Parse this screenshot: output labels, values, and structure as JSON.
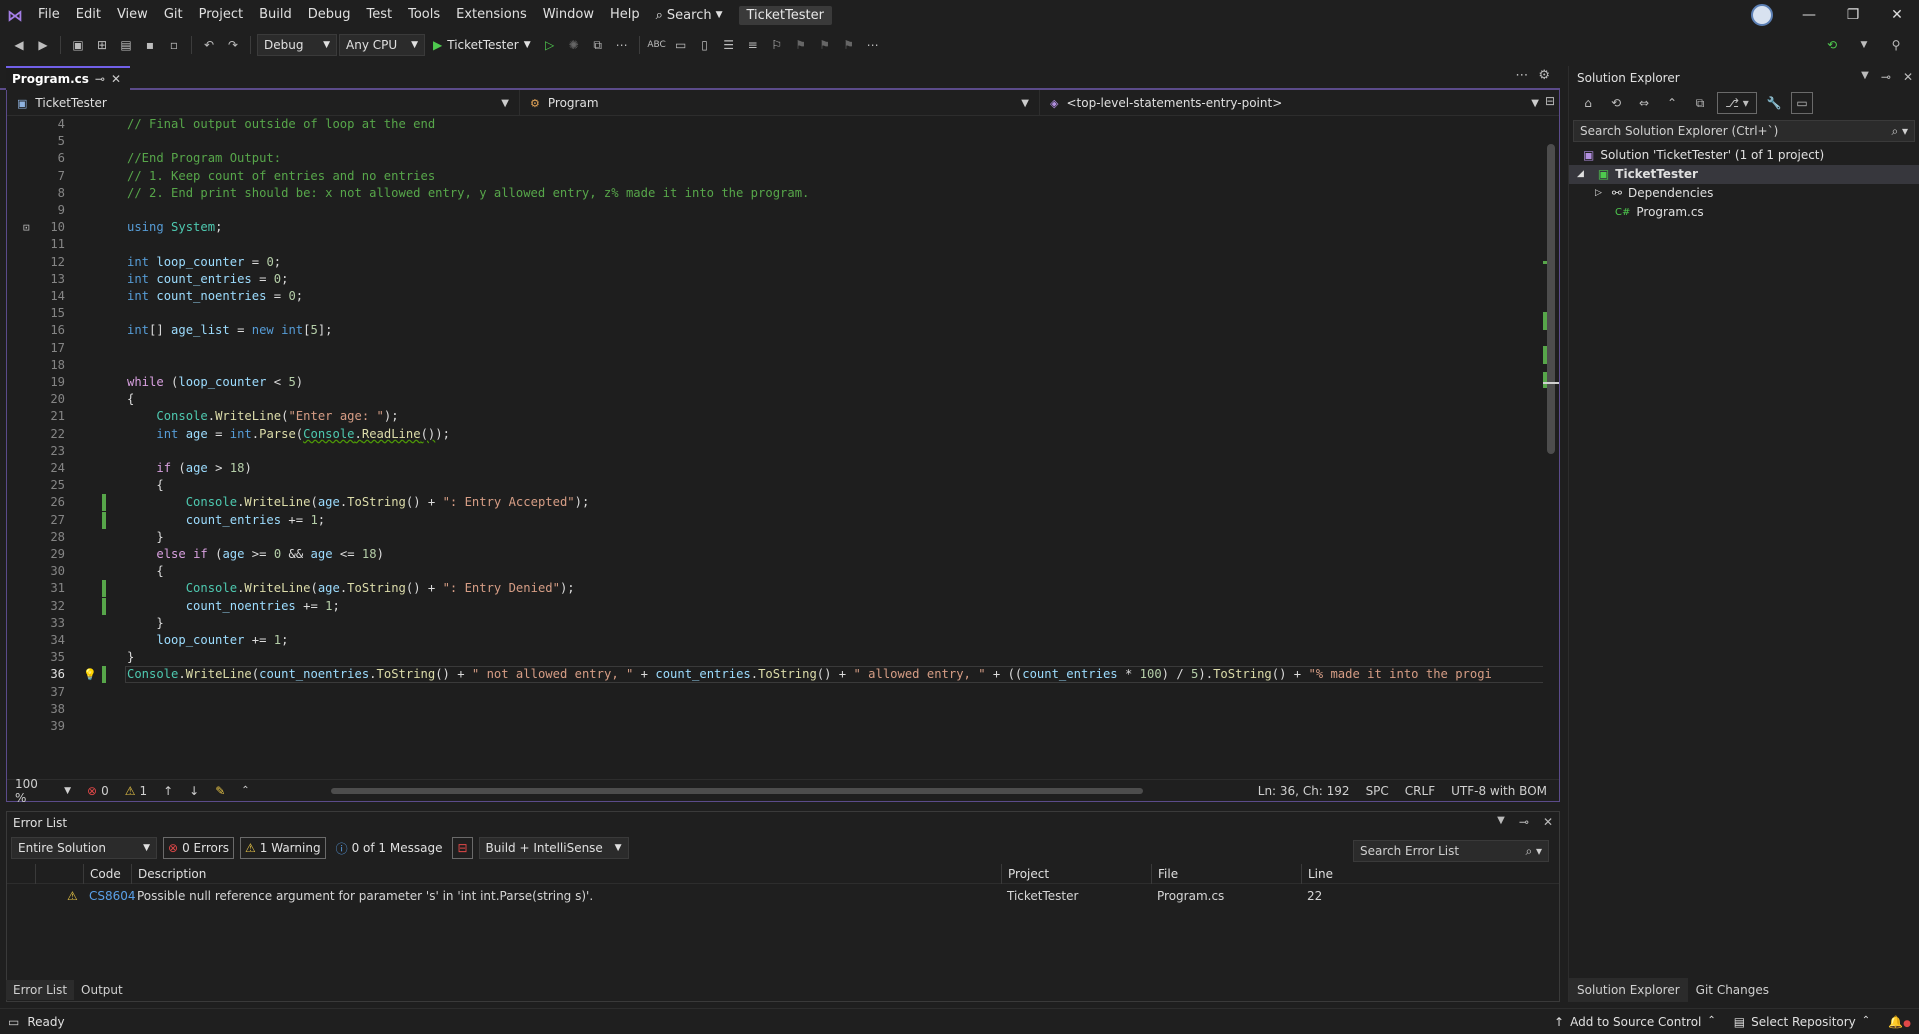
{
  "menu": {
    "items": [
      "File",
      "Edit",
      "View",
      "Git",
      "Project",
      "Build",
      "Debug",
      "Test",
      "Tools",
      "Extensions",
      "Window",
      "Help"
    ],
    "search_label": "Search",
    "solution_title": "TicketTester"
  },
  "toolbar": {
    "config": "Debug",
    "platform": "Any CPU",
    "run_target": "TicketTester"
  },
  "document": {
    "tab_name": "Program.cs",
    "nav_project": "TicketTester",
    "nav_class": "Program",
    "nav_member": "<top-level-statements-entry-point>"
  },
  "code_lines": [
    {
      "n": "4",
      "t": "    // Final output outside of loop at the end"
    },
    {
      "n": "5",
      "t": ""
    },
    {
      "n": "6",
      "t": "    //End Program Output:"
    },
    {
      "n": "7",
      "t": "    // 1. Keep count of entries and no entries"
    },
    {
      "n": "8",
      "t": "    // 2. End print should be: x not allowed entry, y allowed entry, z% made it into the program."
    },
    {
      "n": "9",
      "t": ""
    },
    {
      "n": "10",
      "t": "    using System;"
    },
    {
      "n": "11",
      "t": ""
    },
    {
      "n": "12",
      "t": "    int loop_counter = 0;"
    },
    {
      "n": "13",
      "t": "    int count_entries = 0;"
    },
    {
      "n": "14",
      "t": "    int count_noentries = 0;"
    },
    {
      "n": "15",
      "t": ""
    },
    {
      "n": "16",
      "t": "    int[] age_list = new int[5];"
    },
    {
      "n": "17",
      "t": ""
    },
    {
      "n": "18",
      "t": ""
    },
    {
      "n": "19",
      "t": "    while (loop_counter < 5)"
    },
    {
      "n": "20",
      "t": "    {"
    },
    {
      "n": "21",
      "t": "        Console.WriteLine(\"Enter age: \");"
    },
    {
      "n": "22",
      "t": "        int age = int.Parse(Console.ReadLine());"
    },
    {
      "n": "23",
      "t": ""
    },
    {
      "n": "24",
      "t": "        if (age > 18)"
    },
    {
      "n": "25",
      "t": "        {"
    },
    {
      "n": "26",
      "t": "            Console.WriteLine(age.ToString() + \": Entry Accepted\");"
    },
    {
      "n": "27",
      "t": "            count_entries += 1;"
    },
    {
      "n": "28",
      "t": "        }"
    },
    {
      "n": "29",
      "t": "        else if (age >= 0 && age <= 18)"
    },
    {
      "n": "30",
      "t": "        {"
    },
    {
      "n": "31",
      "t": "            Console.WriteLine(age.ToString() + \": Entry Denied\");"
    },
    {
      "n": "32",
      "t": "            count_noentries += 1;"
    },
    {
      "n": "33",
      "t": "        }"
    },
    {
      "n": "34",
      "t": "        loop_counter += 1;"
    },
    {
      "n": "35",
      "t": "    }"
    },
    {
      "n": "36",
      "t": "    Console.WriteLine(count_noentries.ToString() + \" not allowed entry, \" + count_entries.ToString() + \" allowed entry, \" + ((count_entries * 100) / 5).ToString() + \"% made it into the progi"
    },
    {
      "n": "37",
      "t": ""
    },
    {
      "n": "38",
      "t": ""
    },
    {
      "n": "39",
      "t": ""
    }
  ],
  "editor_status": {
    "zoom": "100 %",
    "errors": "0",
    "warnings": "1",
    "position": "Ln: 36, Ch: 192",
    "indent": "SPC",
    "line_ending": "CRLF",
    "encoding": "UTF-8 with BOM"
  },
  "error_list": {
    "title": "Error List",
    "scope": "Entire Solution",
    "errors_filter": "0 Errors",
    "warnings_filter": "1 Warning",
    "messages_filter": "0 of 1 Message",
    "build_filter": "Build + IntelliSense",
    "search_placeholder": "Search Error List",
    "columns": {
      "code": "Code",
      "description": "Description",
      "project": "Project",
      "file": "File",
      "line": "Line"
    },
    "rows": [
      {
        "code": "CS8604",
        "description": "Possible null reference argument for parameter 's' in 'int int.Parse(string s)'.",
        "project": "TicketTester",
        "file": "Program.cs",
        "line": "22"
      }
    ]
  },
  "bottom_tabs": [
    "Error List",
    "Output"
  ],
  "solution_explorer": {
    "title": "Solution Explorer",
    "search_placeholder": "Search Solution Explorer (Ctrl+`)",
    "solution": "Solution 'TicketTester' (1 of 1 project)",
    "project": "TicketTester",
    "dependencies": "Dependencies",
    "file": "Program.cs",
    "tabs": [
      "Solution Explorer",
      "Git Changes"
    ]
  },
  "statusbar": {
    "state": "Ready",
    "source_control": "Add to Source Control",
    "repo": "Select Repository"
  },
  "colors": {
    "accent": "#7160e8",
    "background": "#1f1f1f",
    "change_bar": "#57a64a",
    "warning": "#e8c547",
    "error": "#e04848"
  }
}
